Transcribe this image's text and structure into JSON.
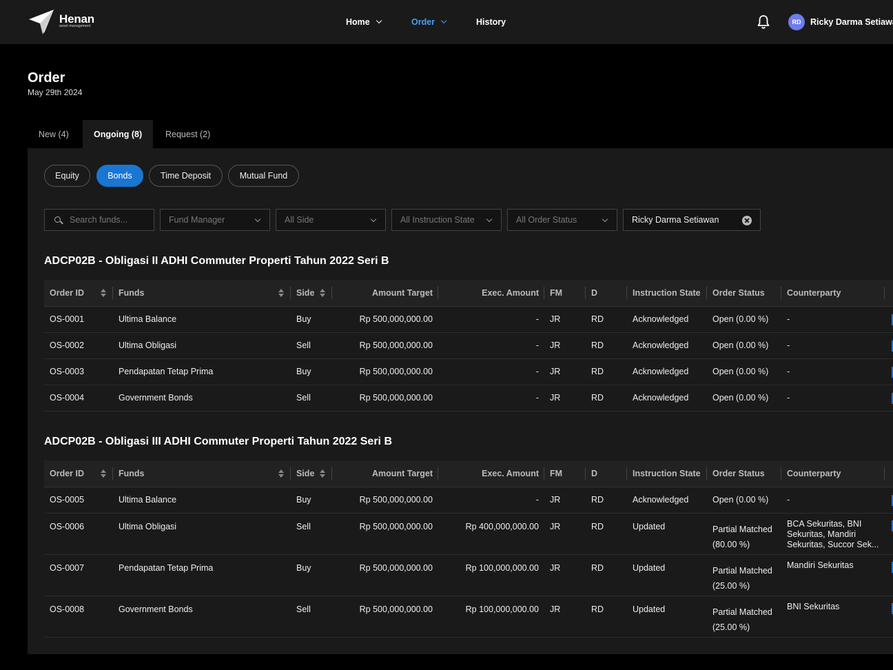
{
  "app": {
    "logo_text": "Henan",
    "logo_subtext": "asset management",
    "nav": [
      {
        "label": "Home",
        "has_dropdown": true
      },
      {
        "label": "Order",
        "has_dropdown": true,
        "active": true
      },
      {
        "label": "History",
        "has_dropdown": false
      }
    ],
    "user": {
      "initials": "RD",
      "name": "Ricky Darma Setiawan"
    }
  },
  "page": {
    "title": "Order",
    "date": "May 29th 2024"
  },
  "tabs": [
    {
      "label": "New (4)",
      "active": false
    },
    {
      "label": "Ongoing (8)",
      "active": true
    },
    {
      "label": "Request (2)",
      "active": false
    }
  ],
  "asset_types": [
    {
      "label": "Equity",
      "active": false
    },
    {
      "label": "Bonds",
      "active": true
    },
    {
      "label": "Time Deposit",
      "active": false
    },
    {
      "label": "Mutual Fund",
      "active": false
    }
  ],
  "filters": {
    "search_placeholder": "Search funds...",
    "fund_manager": "Fund Manager",
    "side": "All Side",
    "instruction_state": "All Instruction State",
    "order_status": "All Order Status",
    "user_filter": "Ricky Darma Setiawan"
  },
  "columns": {
    "order_id": "Order ID",
    "funds": "Funds",
    "side": "Side",
    "amount_target": "Amount Target",
    "exec_amount": "Exec. Amount",
    "fm": "FM",
    "d": "D",
    "instruction_state": "Instruction State",
    "order_status": "Order Status",
    "counterparty": "Counterparty"
  },
  "groups": [
    {
      "title": "ADCP02B - Obligasi II ADHI Commuter Properti Tahun 2022 Seri B",
      "rows": [
        {
          "id": "OS-0001",
          "fund": "Ultima Balance",
          "side": "Buy",
          "amount": "Rp 500,000,000.00",
          "exec": "-",
          "fm": "JR",
          "d": "RD",
          "state": "Acknowledged",
          "status": "Open (0.00 %)",
          "cp": "-"
        },
        {
          "id": "OS-0002",
          "fund": "Ultima Obligasi",
          "side": "Sell",
          "amount": "Rp 500,000,000.00",
          "exec": "-",
          "fm": "JR",
          "d": "RD",
          "state": "Acknowledged",
          "status": "Open (0.00 %)",
          "cp": "-"
        },
        {
          "id": "OS-0003",
          "fund": "Pendapatan Tetap Prima",
          "side": "Buy",
          "amount": "Rp 500,000,000.00",
          "exec": "-",
          "fm": "JR",
          "d": "RD",
          "state": "Acknowledged",
          "status": "Open (0.00 %)",
          "cp": "-"
        },
        {
          "id": "OS-0004",
          "fund": "Government Bonds",
          "side": "Sell",
          "amount": "Rp 500,000,000.00",
          "exec": "-",
          "fm": "JR",
          "d": "RD",
          "state": "Acknowledged",
          "status": "Open (0.00 %)",
          "cp": "-"
        }
      ]
    },
    {
      "title": "ADCP02B - Obligasi III ADHI Commuter Properti Tahun 2022 Seri B",
      "rows": [
        {
          "id": "OS-0005",
          "fund": "Ultima Balance",
          "side": "Buy",
          "amount": "Rp 500,000,000.00",
          "exec": "-",
          "fm": "JR",
          "d": "RD",
          "state": "Acknowledged",
          "status": "Open (0.00 %)",
          "cp": "-"
        },
        {
          "id": "OS-0006",
          "fund": "Ultima Obligasi",
          "side": "Sell",
          "amount": "Rp 500,000,000.00",
          "exec": "Rp 400,000,000.00",
          "fm": "JR",
          "d": "RD",
          "state": "Updated",
          "status": "Partial Matched (80.00 %)",
          "cp": "BCA Sekuritas, BNI Sekuritas, Mandiri Sekuritas, Succor Sek..."
        },
        {
          "id": "OS-0007",
          "fund": "Pendapatan Tetap Prima",
          "side": "Buy",
          "amount": "Rp 500,000,000.00",
          "exec": "Rp 100,000,000.00",
          "fm": "JR",
          "d": "RD",
          "state": "Updated",
          "status": "Partial Matched (25.00 %)",
          "cp": "Mandiri Sekuritas"
        },
        {
          "id": "OS-0008",
          "fund": "Government Bonds",
          "side": "Sell",
          "amount": "Rp 500,000,000.00",
          "exec": "Rp 100,000,000.00",
          "fm": "JR",
          "d": "RD",
          "state": "Updated",
          "status": "Partial Matched (25.00 %)",
          "cp": "BNI Sekuritas"
        }
      ]
    }
  ],
  "colors": {
    "accent": "#1976d2",
    "buy": "#2fb36b",
    "sell": "#e0303a",
    "nav_active": "#4a9ff5"
  }
}
